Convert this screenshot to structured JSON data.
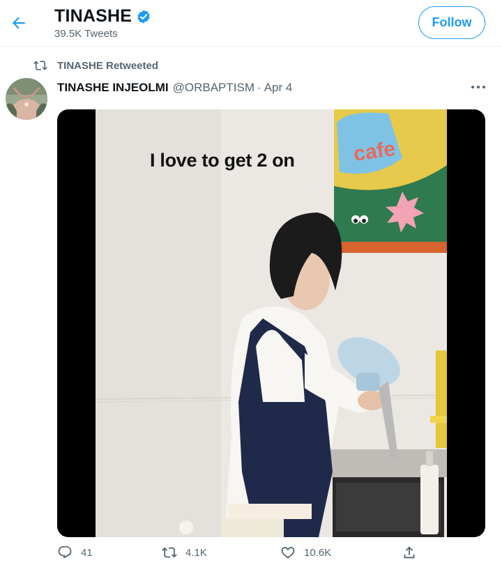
{
  "header": {
    "title": "TINASHE",
    "subtitle": "39.5K Tweets",
    "follow_label": "Follow"
  },
  "social_context": {
    "text": "TINASHE Retweeted"
  },
  "tweet": {
    "author_name": "TINASHE INJEOLMI",
    "handle": "@ORBAPTISM",
    "separator": "·",
    "date": "Apr 4",
    "media": {
      "caption": "I love to get 2 on",
      "sign_text": "cafe"
    }
  },
  "actions": {
    "replies": "41",
    "retweets": "4.1K",
    "likes": "10.6K"
  },
  "colors": {
    "accent": "#1d9bf0",
    "secondary_text": "#536471",
    "divider": "#eff3f4"
  }
}
